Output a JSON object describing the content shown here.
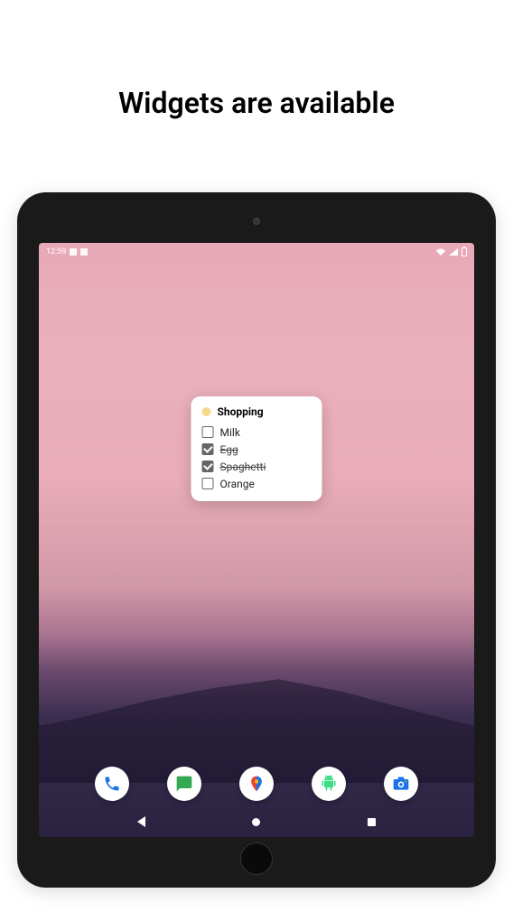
{
  "page": {
    "title": "Widgets are available"
  },
  "status_bar": {
    "time": "12:59"
  },
  "widget": {
    "title": "Shopping",
    "dot_color": "#f7d88c",
    "items": [
      {
        "label": "Milk",
        "checked": false
      },
      {
        "label": "Egg",
        "checked": true
      },
      {
        "label": "Spaghetti",
        "checked": true
      },
      {
        "label": "Orange",
        "checked": false
      }
    ]
  },
  "dock": {
    "apps": [
      {
        "name": "phone",
        "color": "#1a73e8"
      },
      {
        "name": "messages",
        "color": "#34a853"
      },
      {
        "name": "maps",
        "color": "#ea4335"
      },
      {
        "name": "android",
        "color": "#3ddc84"
      },
      {
        "name": "camera",
        "color": "#1a73e8"
      }
    ]
  }
}
